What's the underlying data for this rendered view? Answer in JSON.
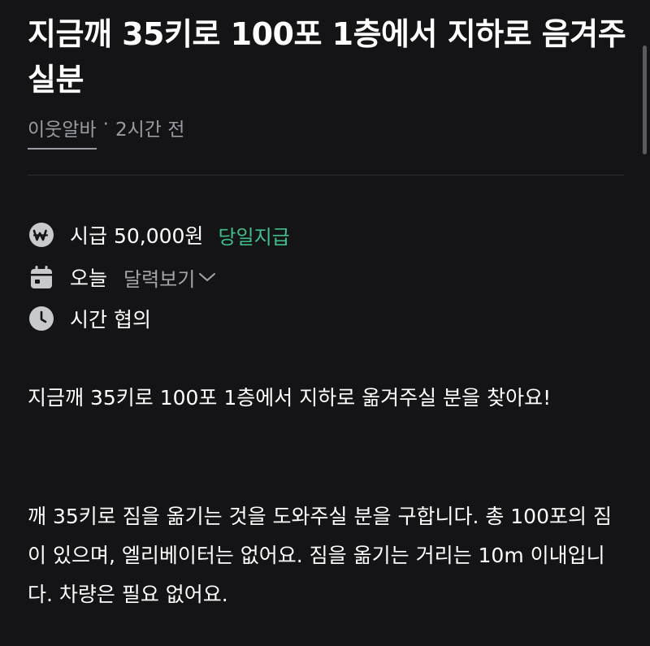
{
  "post": {
    "title": "지금깨 35키로 100포 1층에서 지하로 음겨주실분",
    "author": "이웃알바",
    "separator": "·",
    "time_ago": "2시간 전"
  },
  "details": {
    "wage_text": "시급 50,000원",
    "wage_tag": "당일지급",
    "date_text": "오늘",
    "calendar_link": "달력보기",
    "time_text": "시간 협의"
  },
  "description": {
    "paragraph_1": "지금깨 35키로 100포 1층에서 지하로 옮겨주실 분을 찾아요!",
    "paragraph_2": "깨 35키로 짐을 옮기는 것을 도와주실 분을 구합니다. 총 100포의 짐이 있으며, 엘리베이터는 없어요. 짐을 옮기는 거리는 10m 이내입니다. 차량은 필요 없어요."
  },
  "icons": {
    "wage": "won-coin-icon",
    "date": "calendar-icon",
    "time": "clock-icon",
    "calendar_link": "chevron-down-icon"
  },
  "colors": {
    "background": "#141416",
    "text_primary": "#ffffff",
    "text_secondary": "#9a9ca3",
    "accent_green": "#3fbf8a",
    "icon_gray": "#c8c9cd"
  }
}
